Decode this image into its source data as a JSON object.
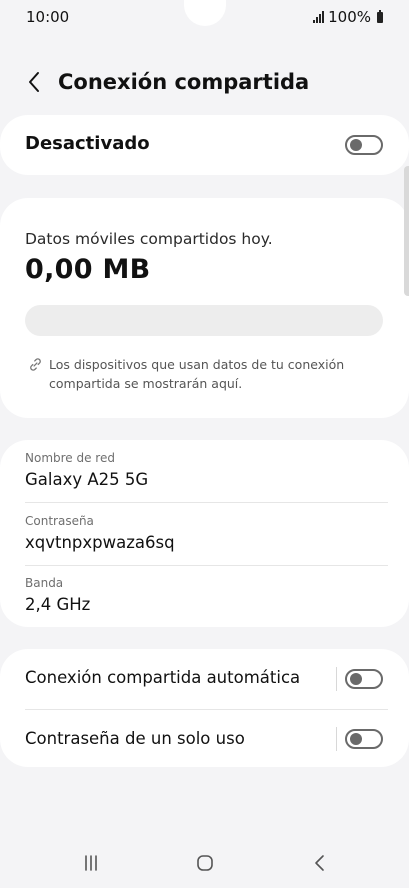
{
  "status_bar": {
    "time": "10:00",
    "battery": "100%",
    "signal_icon": "signal-bars-icon",
    "battery_icon": "battery-icon"
  },
  "header": {
    "back_icon": "chevron-left-icon",
    "title": "Conexión compartida"
  },
  "master_toggle": {
    "label": "Desactivado",
    "on": false
  },
  "usage": {
    "label": "Datos móviles compartidos hoy.",
    "value": "0,00 MB",
    "progress_percent": 0,
    "note_icon": "link-icon",
    "note": "Los dispositivos que usan datos de tu conexión compartida se mostrarán aquí."
  },
  "network": {
    "rows": [
      {
        "key": "Nombre de red",
        "value": "Galaxy A25 5G"
      },
      {
        "key": "Contraseña",
        "value": "xqvtnpxpwaza6sq"
      },
      {
        "key": "Banda",
        "value": "2,4 GHz"
      }
    ]
  },
  "settings": {
    "items": [
      {
        "label": "Conexión compartida automática",
        "on": false
      },
      {
        "label": "Contraseña de un solo uso",
        "on": false
      }
    ]
  },
  "navbar": {
    "recents_icon": "recents-icon",
    "home_icon": "home-icon",
    "back_icon": "back-icon"
  },
  "colors": {
    "background": "#f4f4f6",
    "card": "#ffffff",
    "toggle_off": "#6a6a6a",
    "progress_track": "#ededed"
  }
}
